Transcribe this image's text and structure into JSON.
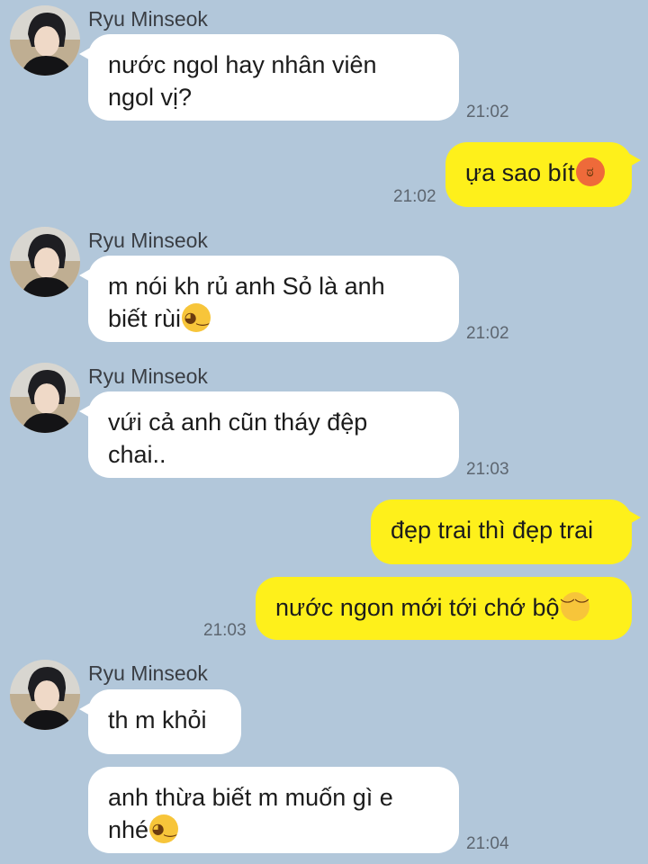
{
  "messages": [
    {
      "sender": "Ryu Minseok",
      "lines": [
        "nước ngol hay nhân viên",
        "ngol vị?"
      ],
      "time": "21:02"
    },
    {
      "text": "ựa sao bít",
      "emoji": "angry-face-icon",
      "time": "21:02"
    },
    {
      "sender": "Ryu Minseok",
      "lines": [
        "m nói kh rủ anh Sỏ là anh",
        "biết rùi"
      ],
      "emoji": "smirk-face-icon",
      "time": "21:02"
    },
    {
      "sender": "Ryu Minseok",
      "lines": [
        "vứi cả anh cũn tháy đệp",
        "chai.."
      ],
      "time": "21:03"
    },
    {
      "text": "đẹp trai thì đẹp trai"
    },
    {
      "text": "nước ngon mới tới chớ bộ",
      "emoji": "pensive-face-icon",
      "time": "21:03"
    },
    {
      "sender": "Ryu Minseok",
      "text": "th m khỏi"
    },
    {
      "lines": [
        "anh thừa biết m muốn gì e",
        "nhé"
      ],
      "emoji": "smirk-face-icon",
      "time": "21:04"
    }
  ],
  "colors": {
    "background": "#b2c7da",
    "incoming_bubble": "#ffffff",
    "outgoing_bubble": "#fef01b"
  }
}
